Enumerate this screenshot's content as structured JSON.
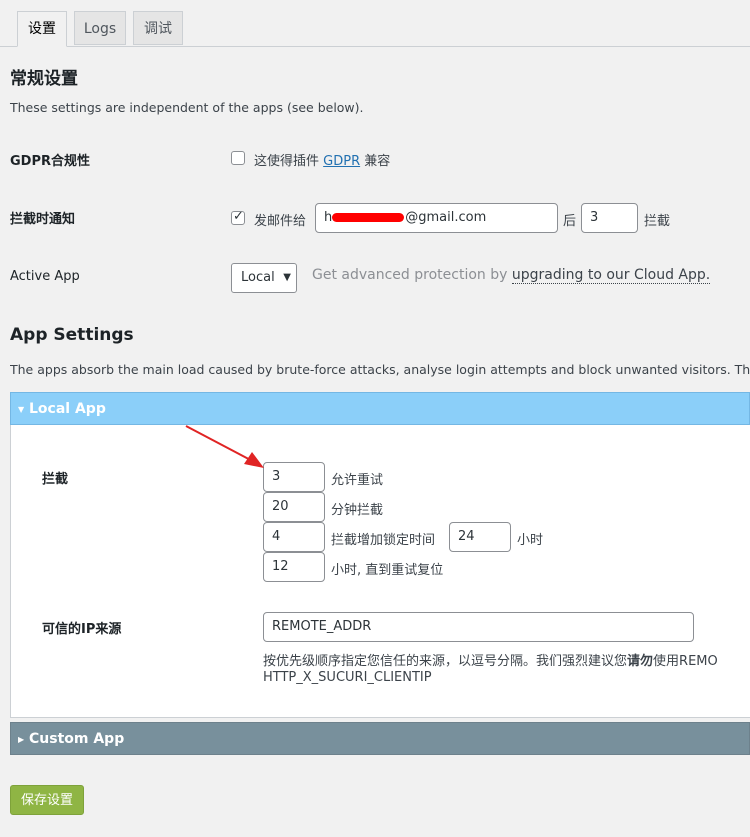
{
  "tabs": [
    {
      "label": "设置",
      "active": true
    },
    {
      "label": "Logs",
      "active": false
    },
    {
      "label": "调试",
      "active": false
    }
  ],
  "general": {
    "title": "常规设置",
    "description": "These settings are independent of the apps (see below).",
    "gdpr": {
      "label": "GDPR合规性",
      "checked": false,
      "text_before": "这使得插件",
      "link": "GDPR",
      "text_after": "兼容"
    },
    "notify": {
      "label": "拦截时通知",
      "checked": true,
      "text_before": "发邮件给",
      "email_prefix": "h",
      "email_suffix": "@gmail.com",
      "after": "后",
      "count": "3",
      "suffix": "拦截"
    },
    "active_app": {
      "label": "Active App",
      "selected": "Local",
      "upgrade_text": "Get advanced protection by",
      "upgrade_link": "upgrading to our Cloud App."
    }
  },
  "app_settings": {
    "title": "App Settings",
    "description": "The apps absorb the main load caused by brute-force attacks, analyse login attempts and block unwanted visitors. They might pro"
  },
  "local_app": {
    "title": "Local App",
    "lockout": {
      "label": "拦截",
      "retries": "3",
      "retries_label": "允许重试",
      "minutes": "20",
      "minutes_label": "分钟拦截",
      "lockouts": "4",
      "lockouts_label": "拦截增加锁定时间",
      "hours": "24",
      "hours_label": "小时",
      "reset": "12",
      "reset_label": "小时, 直到重试复位"
    },
    "trusted_ip": {
      "label": "可信的IP来源",
      "value": "REMOTE_ADDR",
      "help_line1_a": "按优先级顺序指定您信任的来源，以逗号分隔。我们强烈建议您",
      "help_line1_bold": "请勿",
      "help_line1_b": "使用REMO",
      "help_line2": "HTTP_X_SUCURI_CLIENTIP"
    }
  },
  "custom_app": {
    "title": "Custom App"
  },
  "save_button": "保存设置",
  "colors": {
    "local_header": "#8bcff9",
    "custom_header": "#78909c",
    "save_button": "#8fb544",
    "link": "#2271b1",
    "arrow": "#e02424"
  }
}
